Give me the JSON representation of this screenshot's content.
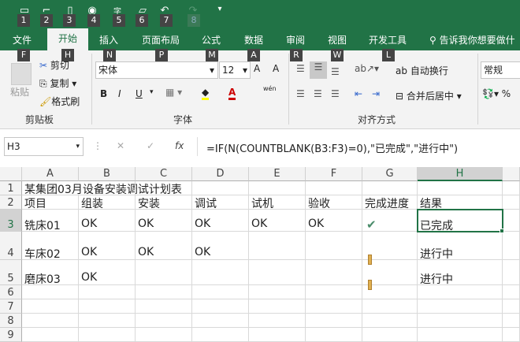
{
  "quick_access": {
    "keys": [
      "1",
      "2",
      "3",
      "4",
      "5",
      "6",
      "7",
      "8"
    ]
  },
  "tabs": [
    {
      "label": "文件",
      "key": "F"
    },
    {
      "label": "开始",
      "key": "H"
    },
    {
      "label": "插入",
      "key": "N"
    },
    {
      "label": "页面布局",
      "key": "P"
    },
    {
      "label": "公式",
      "key": "M"
    },
    {
      "label": "数据",
      "key": "A"
    },
    {
      "label": "审阅",
      "key": "R"
    },
    {
      "label": "视图",
      "key": "W"
    },
    {
      "label": "开发工具",
      "key": "L"
    }
  ],
  "tell_me": "告诉我你想要做什",
  "clipboard": {
    "paste": "粘贴",
    "cut": "剪切",
    "copy": "复制",
    "format_painter": "格式刷",
    "group": "剪贴板"
  },
  "font": {
    "name": "宋体",
    "size": "12",
    "bold": "B",
    "italic": "I",
    "underline": "U",
    "wen": "wén",
    "group": "字体"
  },
  "alignment": {
    "wrap": "自动换行",
    "merge": "合并后居中",
    "group": "对齐方式"
  },
  "number": {
    "format": "常规",
    "percent": "%"
  },
  "formula_bar": {
    "name_box": "H3",
    "fx": "fx",
    "formula": "=IF(N(COUNTBLANK(B3:F3)=0),\"已完成\",\"进行中\")"
  },
  "sheet": {
    "columns": [
      "A",
      "B",
      "C",
      "D",
      "E",
      "F",
      "G",
      "H"
    ],
    "rows": [
      "1",
      "2",
      "3",
      "4",
      "5",
      "6",
      "7",
      "8",
      "9"
    ],
    "title": "某集团03月设备安装调试计划表",
    "headers": [
      "项目",
      "组装",
      "安装",
      "调试",
      "试机",
      "验收",
      "完成进度",
      "结果"
    ],
    "data": [
      {
        "item": "铣床01",
        "cells": [
          "OK",
          "OK",
          "OK",
          "OK",
          "OK"
        ],
        "progress_icon": "check-icon",
        "result": "已完成"
      },
      {
        "item": "车床02",
        "cells": [
          "OK",
          "OK",
          "OK",
          "",
          ""
        ],
        "progress_icon": "exclamation-icon",
        "result": "进行中"
      },
      {
        "item": "磨床03",
        "cells": [
          "OK",
          "",
          "",
          "",
          ""
        ],
        "progress_icon": "exclamation-icon",
        "result": "进行中"
      }
    ],
    "selected_cell": "H3"
  },
  "colors": {
    "accent": "#217346",
    "check": "#4a8c6a",
    "flag": "#e0b050"
  }
}
